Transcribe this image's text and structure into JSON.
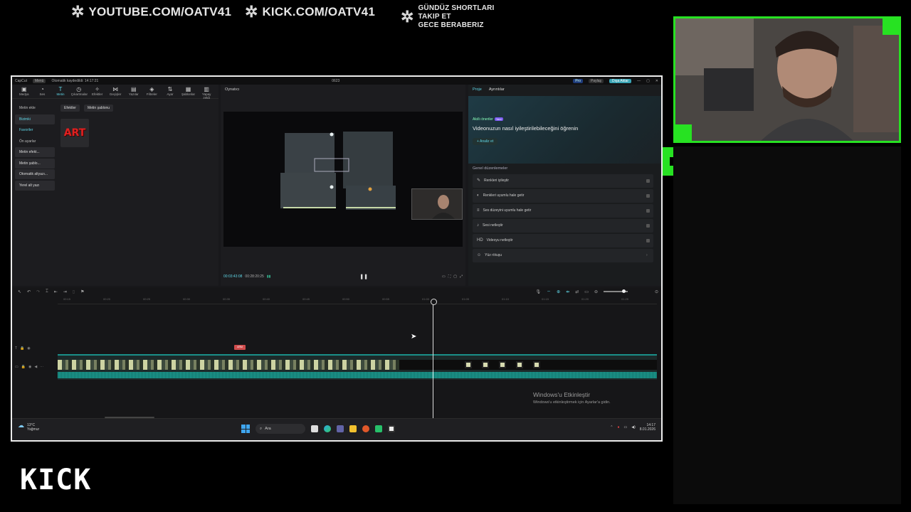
{
  "banner": {
    "youtube": "YOUTUBE.COM/OATV41",
    "kick": "KICK.COM/OATV41",
    "shorts_line1": "GÜNDÜZ SHORTLARI",
    "shorts_line2": "TAKIP ET",
    "shorts_line3": "GECE BERABERIZ"
  },
  "overlay_logo": "KICK",
  "editor": {
    "app_name": "CapCut",
    "menu_label": "Menü",
    "autosave_text": "Otomatik kaydedildi: 14:17:21",
    "project_name": "0623",
    "pro_label": "Pro",
    "share_label": "Paylaş",
    "export_label": "Dışa Aktar",
    "toolbar": [
      "Medya",
      "Ses",
      "Metin",
      "Çıkartmalar",
      "Efektler",
      "Geçişler",
      "Yazılar",
      "Filtreler",
      "Ayar",
      "Şablonlar",
      "Yapay zekâ"
    ],
    "active_tool": "Metin",
    "leftnav": [
      "Metin ekle",
      "Bizimki",
      "Favoriler",
      "Ön ayarlar",
      "Metin efekt...",
      "Metin şablo...",
      "Otomatik altyazı...",
      "Yerel alt yazı"
    ],
    "tabs": [
      "Efektler",
      "Metin şablonu"
    ],
    "asset_label": "ART",
    "player_title": "Oynatıcı",
    "timecode_current": "00:03:43:08",
    "timecode_total": "00:28:20:25",
    "details_tabs": [
      "Proje",
      "Ayrıntılar"
    ],
    "ai_small": "Akıllı öneriler",
    "ai_badge": "Yeni",
    "ai_title": "Videonuzun nasıl iyileştirilebileceğini öğrenin",
    "ai_button": "Analiz et",
    "general_title": "Genel düzenlemeler",
    "general_items": [
      {
        "label": "Renkleri iyileştir",
        "icon": "wand-icon"
      },
      {
        "label": "Renkleri uyumlu hale getir",
        "icon": "palette-icon"
      },
      {
        "label": "Ses düzeyini uyumlu hale getir",
        "icon": "volume-icon"
      },
      {
        "label": "Sesi netleştir",
        "icon": "sound-icon"
      },
      {
        "label": "Videoyu netleştir",
        "icon": "hd-icon"
      },
      {
        "label": "Yüz rötuşu",
        "icon": "face-icon"
      }
    ],
    "ruler_ticks": [
      "00:15",
      "00:20",
      "00:25",
      "00:30",
      "00:35",
      "00:40",
      "00:45",
      "00:50",
      "00:55",
      "01:00",
      "01:05",
      "01:10",
      "01:15",
      "01:20",
      "01:25"
    ],
    "text_clip_label": "ARM",
    "activate_title": "Windows'u Etkinleştir",
    "activate_sub": "Windows'u etkinleştirmek için Ayarlar'a gidin."
  },
  "taskbar": {
    "temperature": "13°C",
    "weather": "Yağmur",
    "search_placeholder": "Ara",
    "time": "14:17",
    "date": "8.01.2026"
  }
}
